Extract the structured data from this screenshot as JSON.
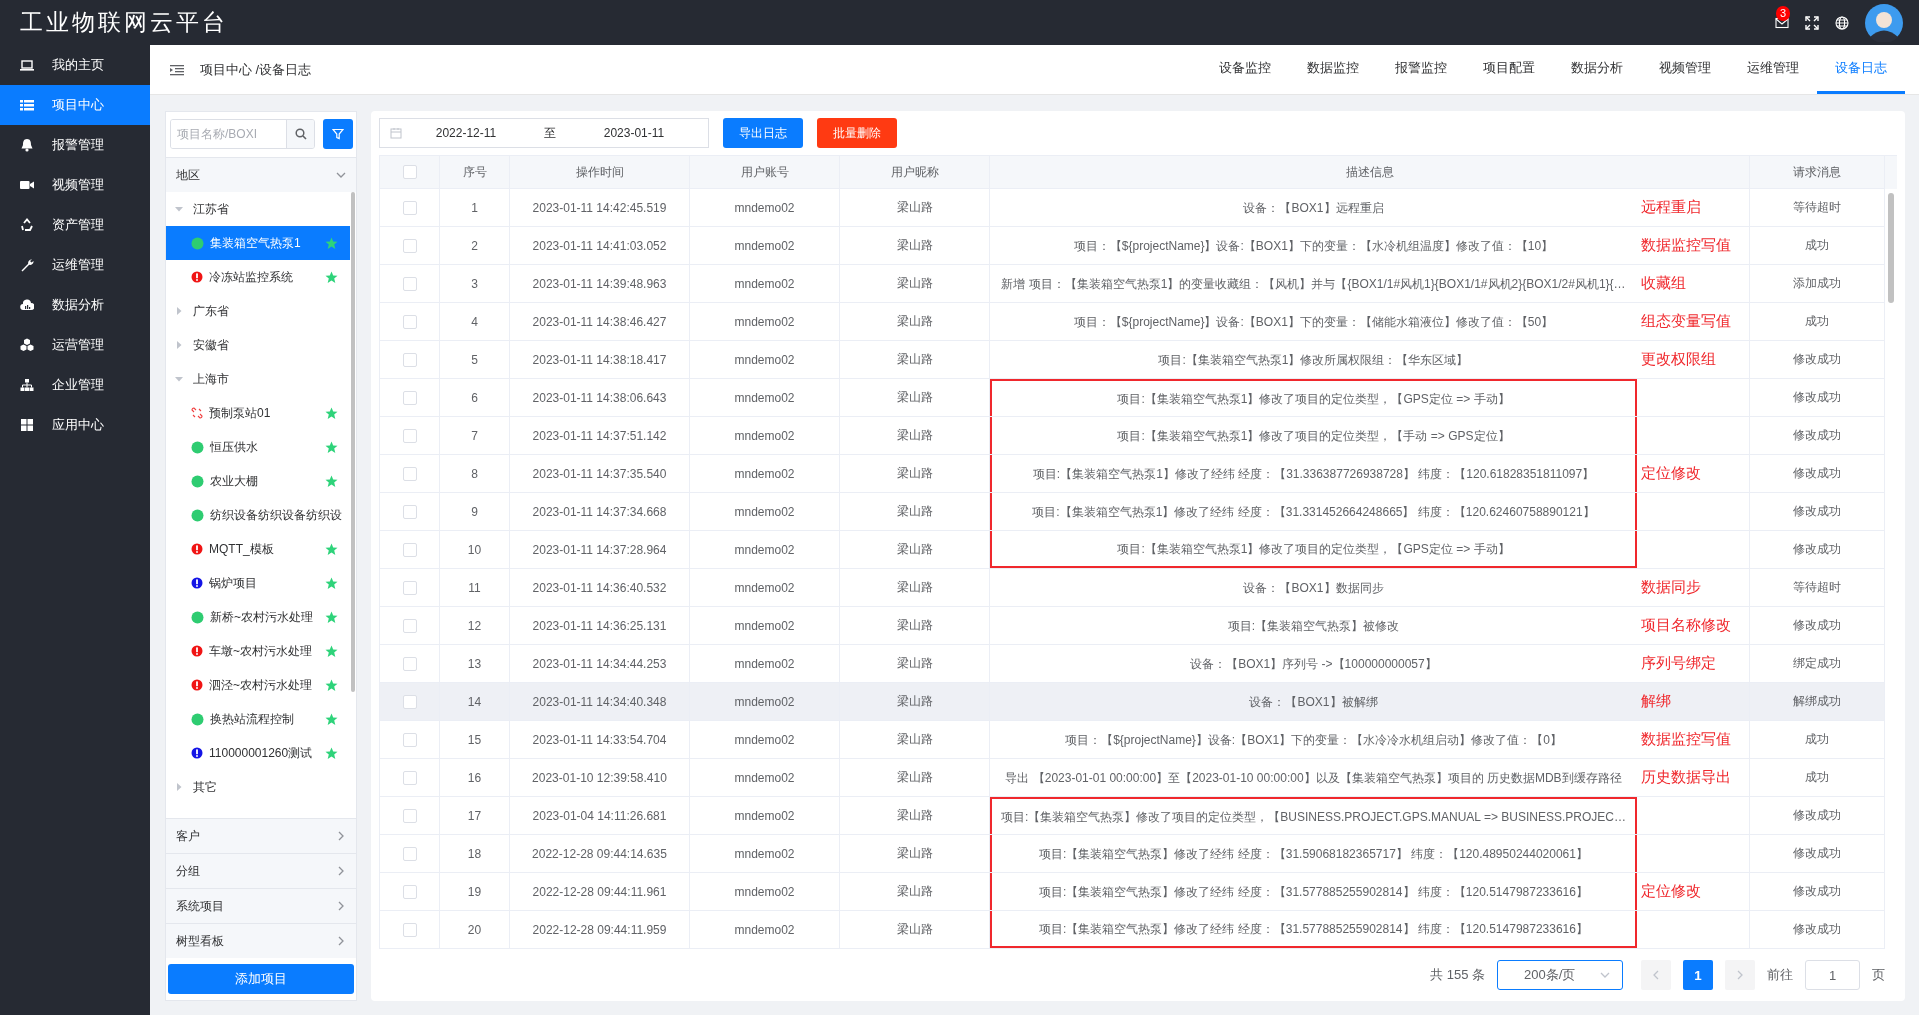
{
  "topbar": {
    "title": "工业物联网云平台",
    "notification_count": "3"
  },
  "sidebar": {
    "items": [
      {
        "label": "我的主页",
        "selected": false
      },
      {
        "label": "项目中心",
        "selected": true
      },
      {
        "label": "报警管理",
        "selected": false
      },
      {
        "label": "视频管理",
        "selected": false
      },
      {
        "label": "资产管理",
        "selected": false
      },
      {
        "label": "运维管理",
        "selected": false
      },
      {
        "label": "数据分析",
        "selected": false
      },
      {
        "label": "运营管理",
        "selected": false
      },
      {
        "label": "企业管理",
        "selected": false
      },
      {
        "label": "应用中心",
        "selected": false
      }
    ]
  },
  "breadcrumb": "项目中心 /设备日志",
  "tabs": [
    {
      "label": "设备监控",
      "selected": false
    },
    {
      "label": "数据监控",
      "selected": false
    },
    {
      "label": "报警监控",
      "selected": false
    },
    {
      "label": "项目配置",
      "selected": false
    },
    {
      "label": "数据分析",
      "selected": false
    },
    {
      "label": "视频管理",
      "selected": false
    },
    {
      "label": "运维管理",
      "selected": false
    },
    {
      "label": "设备日志",
      "selected": true
    }
  ],
  "project_panel": {
    "search": {
      "placeholder": "项目名称/BOXI"
    },
    "sections": [
      {
        "label": "地区",
        "expanded": true,
        "tree": [
          {
            "label": "江苏省",
            "expanded": true,
            "children": [
              {
                "label": "集装箱空气热泵1",
                "kind": "online",
                "starred": true,
                "selected": true
              },
              {
                "label": "冷冻站监控系统",
                "kind": "alarm",
                "starred": true,
                "selected": false
              }
            ]
          },
          {
            "label": "广东省",
            "expanded": false
          },
          {
            "label": "安徽省",
            "expanded": false
          },
          {
            "label": "上海市",
            "expanded": true,
            "children": [
              {
                "label": "预制泵站01",
                "kind": "disconnected",
                "starred": true,
                "selected": false
              },
              {
                "label": "恒压供水",
                "kind": "online",
                "starred": true,
                "selected": false
              },
              {
                "label": "农业大棚",
                "kind": "online",
                "starred": true,
                "selected": false
              },
              {
                "label": "纺织设备纺织设备纺织设",
                "kind": "online",
                "starred": false,
                "selected": false
              },
              {
                "label": "MQTT_模板",
                "kind": "alarm",
                "starred": true,
                "selected": false
              },
              {
                "label": "锅炉项目",
                "kind": "offline",
                "starred": true,
                "selected": false
              },
              {
                "label": "新桥~农村污水处理",
                "kind": "online",
                "starred": true,
                "selected": false
              },
              {
                "label": "车墩~农村污水处理",
                "kind": "alarm",
                "starred": true,
                "selected": false
              },
              {
                "label": "泗泾~农村污水处理",
                "kind": "alarm",
                "starred": true,
                "selected": false
              },
              {
                "label": "换热站流程控制",
                "kind": "online",
                "starred": true,
                "selected": false
              },
              {
                "label": "110000001260测试",
                "kind": "offline",
                "starred": true,
                "selected": false
              }
            ]
          },
          {
            "label": "其它",
            "expanded": false
          }
        ]
      },
      {
        "label": "客户",
        "expanded": false
      },
      {
        "label": "分组",
        "expanded": false
      },
      {
        "label": "系统项目",
        "expanded": false
      },
      {
        "label": "树型看板",
        "expanded": false
      }
    ],
    "add_button": "添加项目"
  },
  "toolbar": {
    "date_range": {
      "start": "2022-12-11",
      "separator": "至",
      "end": "2023-01-11"
    },
    "buttons": [
      {
        "label": "导出日志",
        "kind": "primary"
      },
      {
        "label": "批量删除",
        "kind": "danger"
      }
    ]
  },
  "table": {
    "header_checked": false,
    "columns": [
      "序号",
      "操作时间",
      "用户账号",
      "用户昵称",
      "描述信息",
      "请求消息"
    ],
    "rows": [
      {
        "checked": false,
        "highlighted": false,
        "boxed": false,
        "no": "1",
        "time": "2023-01-11 14:42:45.519",
        "account": "mndemo02",
        "nickname": "梁山路",
        "description": "设备：【BOX1】远程重启",
        "note": "远程重启",
        "result": "等待超时"
      },
      {
        "checked": false,
        "highlighted": false,
        "boxed": false,
        "no": "2",
        "time": "2023-01-11 14:41:03.052",
        "account": "mndemo02",
        "nickname": "梁山路",
        "description": "项目：【${projectName}】设备:【BOX1】下的变量：【水冷机组温度】修改了值：【10】",
        "note": "数据监控写值",
        "result": "成功"
      },
      {
        "checked": false,
        "highlighted": false,
        "boxed": false,
        "no": "3",
        "time": "2023-01-11 14:39:48.963",
        "account": "mndemo02",
        "nickname": "梁山路",
        "description": "新增 项目：【集装箱空气热泵1】的变量收藏组：【风机】并与【{BOX1/1#风机1}{BOX1/1#风机2}{BOX1/2#风机1}{…",
        "note": "收藏组",
        "result": "添加成功"
      },
      {
        "checked": false,
        "highlighted": false,
        "boxed": false,
        "no": "4",
        "time": "2023-01-11 14:38:46.427",
        "account": "mndemo02",
        "nickname": "梁山路",
        "description": "项目：【${projectName}】设备:【BOX1】下的变量：【储能水箱液位】修改了值：【50】",
        "note": "组态变量写值",
        "result": "成功"
      },
      {
        "checked": false,
        "highlighted": false,
        "boxed": false,
        "no": "5",
        "time": "2023-01-11 14:38:18.417",
        "account": "mndemo02",
        "nickname": "梁山路",
        "description": "项目:【集装箱空气热泵1】修改所属权限组：【华东区域】",
        "note": "更改权限组",
        "result": "修改成功"
      },
      {
        "checked": false,
        "highlighted": false,
        "boxed": true,
        "no": "6",
        "time": "2023-01-11 14:38:06.643",
        "account": "mndemo02",
        "nickname": "梁山路",
        "description": "项目:【集装箱空气热泵1】修改了项目的定位类型，【GPS定位 => 手动】",
        "result": "修改成功"
      },
      {
        "checked": false,
        "highlighted": false,
        "boxed": true,
        "no": "7",
        "time": "2023-01-11 14:37:51.142",
        "account": "mndemo02",
        "nickname": "梁山路",
        "description": "项目:【集装箱空气热泵1】修改了项目的定位类型，【手动 => GPS定位】",
        "result": "修改成功"
      },
      {
        "checked": false,
        "highlighted": false,
        "boxed": true,
        "no": "8",
        "time": "2023-01-11 14:37:35.540",
        "account": "mndemo02",
        "nickname": "梁山路",
        "description": "项目:【集装箱空气热泵1】修改了经纬 经度：【31.336387726938728】 纬度：【120.61828351811097】",
        "note": "定位修改",
        "result": "修改成功"
      },
      {
        "checked": false,
        "highlighted": false,
        "boxed": true,
        "no": "9",
        "time": "2023-01-11 14:37:34.668",
        "account": "mndemo02",
        "nickname": "梁山路",
        "description": "项目:【集装箱空气热泵1】修改了经纬 经度：【31.331452664248665】 纬度：【120.62460758890121】",
        "result": "修改成功"
      },
      {
        "checked": false,
        "highlighted": false,
        "boxed": true,
        "no": "10",
        "time": "2023-01-11 14:37:28.964",
        "account": "mndemo02",
        "nickname": "梁山路",
        "description": "项目:【集装箱空气热泵1】修改了项目的定位类型，【GPS定位 => 手动】",
        "result": "修改成功"
      },
      {
        "checked": false,
        "highlighted": false,
        "boxed": false,
        "no": "11",
        "time": "2023-01-11 14:36:40.532",
        "account": "mndemo02",
        "nickname": "梁山路",
        "description": "设备：【BOX1】数据同步",
        "note": "数据同步",
        "result": "等待超时"
      },
      {
        "checked": false,
        "highlighted": false,
        "boxed": false,
        "no": "12",
        "time": "2023-01-11 14:36:25.131",
        "account": "mndemo02",
        "nickname": "梁山路",
        "description": "项目:【集装箱空气热泵】被修改",
        "note": "项目名称修改",
        "result": "修改成功"
      },
      {
        "checked": false,
        "highlighted": false,
        "boxed": false,
        "no": "13",
        "time": "2023-01-11 14:34:44.253",
        "account": "mndemo02",
        "nickname": "梁山路",
        "description": "设备：【BOX1】序列号 ->【100000000057】",
        "note": "序列号绑定",
        "result": "绑定成功"
      },
      {
        "checked": false,
        "highlighted": true,
        "boxed": false,
        "no": "14",
        "time": "2023-01-11 14:34:40.348",
        "account": "mndemo02",
        "nickname": "梁山路",
        "description": "设备：【BOX1】被解绑",
        "note": "解绑",
        "result": "解绑成功"
      },
      {
        "checked": false,
        "highlighted": false,
        "boxed": false,
        "no": "15",
        "time": "2023-01-11 14:33:54.704",
        "account": "mndemo02",
        "nickname": "梁山路",
        "description": "项目：【${projectName}】设备:【BOX1】下的变量：【水冷冷水机组启动】修改了值：【0】",
        "note": "数据监控写值",
        "result": "成功"
      },
      {
        "checked": false,
        "highlighted": false,
        "boxed": false,
        "no": "16",
        "time": "2023-01-10 12:39:58.410",
        "account": "mndemo02",
        "nickname": "梁山路",
        "description": "导出 【2023-01-01 00:00:00】至【2023-01-10 00:00:00】以及【集装箱空气热泵】项目的 历史数据MDB到缓存路径",
        "note": "历史数据导出",
        "result": "成功"
      },
      {
        "checked": false,
        "highlighted": false,
        "boxed": true,
        "no": "17",
        "time": "2023-01-04 14:11:26.681",
        "account": "mndemo02",
        "nickname": "梁山路",
        "description": "项目:【集装箱空气热泵】修改了项目的定位类型，【BUSINESS.PROJECT.GPS.MANUAL => BUSINESS.PROJEC…",
        "result": "修改成功"
      },
      {
        "checked": false,
        "highlighted": false,
        "boxed": true,
        "no": "18",
        "time": "2022-12-28 09:44:14.635",
        "account": "mndemo02",
        "nickname": "梁山路",
        "description": "项目:【集装箱空气热泵】修改了经纬 经度：【31.59068182365717】 纬度：【120.48950244020061】",
        "result": "修改成功"
      },
      {
        "checked": false,
        "highlighted": false,
        "boxed": true,
        "no": "19",
        "time": "2022-12-28 09:44:11.961",
        "account": "mndemo02",
        "nickname": "梁山路",
        "description": "项目:【集装箱空气热泵】修改了经纬 经度：【31.577885255902814】 纬度：【120.5147987233616】",
        "note": "定位修改",
        "result": "修改成功"
      },
      {
        "checked": false,
        "highlighted": false,
        "boxed": true,
        "no": "20",
        "time": "2022-12-28 09:44:11.959",
        "account": "mndemo02",
        "nickname": "梁山路",
        "description": "项目:【集装箱空气热泵】修改了经纬 经度：【31.577885255902814】 纬度：【120.5147987233616】",
        "result": "修改成功"
      }
    ]
  },
  "pagination": {
    "total": "共 155 条",
    "page_size": "200条/页",
    "prev_disabled": true,
    "next_disabled": true,
    "pages": [
      {
        "label": "1",
        "selected": true
      }
    ],
    "goto_label": "前往",
    "goto_value": "1",
    "goto_suffix": "页"
  }
}
